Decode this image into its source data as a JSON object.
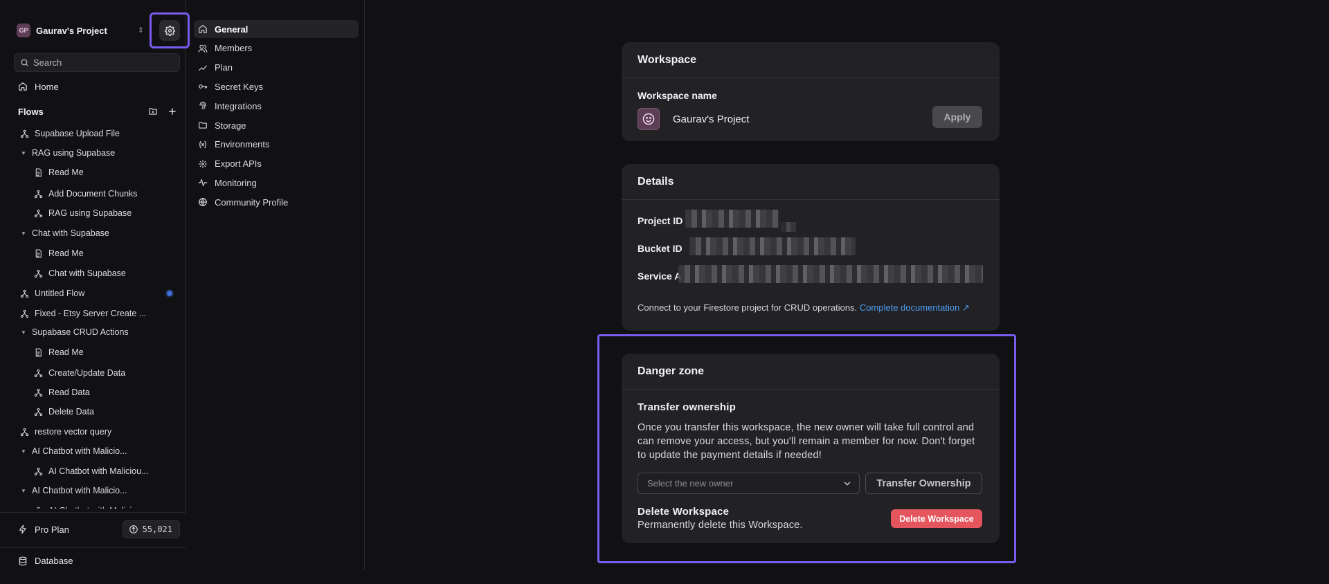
{
  "project": {
    "initials": "GP",
    "name": "Gaurav's Project"
  },
  "search": {
    "placeholder": "Search"
  },
  "nav": {
    "home": "Home",
    "flows": "Flows"
  },
  "tree": [
    {
      "label": "Supabase Upload File",
      "indent": 0,
      "kind": "flow"
    },
    {
      "label": "RAG using Supabase",
      "indent": 0,
      "kind": "folder"
    },
    {
      "label": "Read Me",
      "indent": 1,
      "kind": "doc"
    },
    {
      "label": "Add Document Chunks",
      "indent": 1,
      "kind": "flow"
    },
    {
      "label": "RAG using Supabase",
      "indent": 1,
      "kind": "flow"
    },
    {
      "label": "Chat with Supabase",
      "indent": 0,
      "kind": "folder"
    },
    {
      "label": "Read Me",
      "indent": 1,
      "kind": "doc"
    },
    {
      "label": "Chat with Supabase",
      "indent": 1,
      "kind": "flow"
    },
    {
      "label": "Untitled Flow",
      "indent": 0,
      "kind": "flow",
      "dot": true
    },
    {
      "label": "Fixed - Etsy Server Create ...",
      "indent": 0,
      "kind": "flow"
    },
    {
      "label": "Supabase CRUD Actions",
      "indent": 0,
      "kind": "folder"
    },
    {
      "label": "Read Me",
      "indent": 1,
      "kind": "doc"
    },
    {
      "label": "Create/Update Data",
      "indent": 1,
      "kind": "flow"
    },
    {
      "label": "Read Data",
      "indent": 1,
      "kind": "flow"
    },
    {
      "label": "Delete Data",
      "indent": 1,
      "kind": "flow"
    },
    {
      "label": "restore vector query",
      "indent": 0,
      "kind": "flow"
    },
    {
      "label": "AI Chatbot with Malicio...",
      "indent": 0,
      "kind": "folder"
    },
    {
      "label": "AI Chatbot with Maliciou...",
      "indent": 1,
      "kind": "flow"
    },
    {
      "label": "AI Chatbot with Malicio...",
      "indent": 0,
      "kind": "folder"
    },
    {
      "label": "AI Chatbot with Maliciou...",
      "indent": 1,
      "kind": "flow"
    }
  ],
  "footer": {
    "plan": "Pro Plan",
    "credits": "55,021",
    "database": "Database"
  },
  "settings_nav": [
    {
      "label": "General",
      "icon": "home-icon",
      "active": true
    },
    {
      "label": "Members",
      "icon": "users-icon"
    },
    {
      "label": "Plan",
      "icon": "chart-line-icon"
    },
    {
      "label": "Secret Keys",
      "icon": "key-icon"
    },
    {
      "label": "Integrations",
      "icon": "fingerprint-icon"
    },
    {
      "label": "Storage",
      "icon": "folder-icon"
    },
    {
      "label": "Environments",
      "icon": "variable-icon"
    },
    {
      "label": "Export APIs",
      "icon": "api-icon"
    },
    {
      "label": "Monitoring",
      "icon": "activity-icon"
    },
    {
      "label": "Community Profile",
      "icon": "globe-icon"
    }
  ],
  "workspace": {
    "title": "Workspace",
    "name_label": "Workspace name",
    "name_value": "Gaurav's Project",
    "apply": "Apply"
  },
  "details": {
    "title": "Details",
    "project_id_label": "Project ID",
    "bucket_id_label": "Bucket ID",
    "service_label": "Service A",
    "connect_text": "Connect to your Firestore project for CRUD operations.",
    "doc_link": "Complete documentation ↗"
  },
  "danger": {
    "title": "Danger zone",
    "transfer_title": "Transfer ownership",
    "transfer_desc": "Once you transfer this workspace, the new owner will take full control and can remove your access, but you'll remain a member for now. Don't forget to update the payment details if needed!",
    "select_placeholder": "Select the new owner",
    "transfer_button": "Transfer Ownership",
    "delete_title": "Delete Workspace",
    "delete_desc": "Permanently delete this Workspace.",
    "delete_button": "Delete Workspace"
  },
  "colors": {
    "accent": "#7b5cf0",
    "danger": "#e5555e",
    "link": "#4d9cf5"
  }
}
